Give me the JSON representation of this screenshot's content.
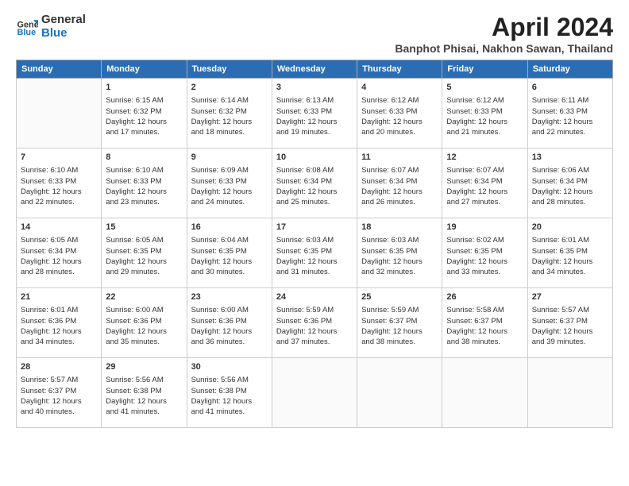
{
  "header": {
    "logo_line1": "General",
    "logo_line2": "Blue",
    "month_title": "April 2024",
    "subtitle": "Banphot Phisai, Nakhon Sawan, Thailand"
  },
  "weekdays": [
    "Sunday",
    "Monday",
    "Tuesday",
    "Wednesday",
    "Thursday",
    "Friday",
    "Saturday"
  ],
  "weeks": [
    [
      {
        "day": "",
        "info": ""
      },
      {
        "day": "1",
        "info": "Sunrise: 6:15 AM\nSunset: 6:32 PM\nDaylight: 12 hours\nand 17 minutes."
      },
      {
        "day": "2",
        "info": "Sunrise: 6:14 AM\nSunset: 6:32 PM\nDaylight: 12 hours\nand 18 minutes."
      },
      {
        "day": "3",
        "info": "Sunrise: 6:13 AM\nSunset: 6:33 PM\nDaylight: 12 hours\nand 19 minutes."
      },
      {
        "day": "4",
        "info": "Sunrise: 6:12 AM\nSunset: 6:33 PM\nDaylight: 12 hours\nand 20 minutes."
      },
      {
        "day": "5",
        "info": "Sunrise: 6:12 AM\nSunset: 6:33 PM\nDaylight: 12 hours\nand 21 minutes."
      },
      {
        "day": "6",
        "info": "Sunrise: 6:11 AM\nSunset: 6:33 PM\nDaylight: 12 hours\nand 22 minutes."
      }
    ],
    [
      {
        "day": "7",
        "info": "Sunrise: 6:10 AM\nSunset: 6:33 PM\nDaylight: 12 hours\nand 22 minutes."
      },
      {
        "day": "8",
        "info": "Sunrise: 6:10 AM\nSunset: 6:33 PM\nDaylight: 12 hours\nand 23 minutes."
      },
      {
        "day": "9",
        "info": "Sunrise: 6:09 AM\nSunset: 6:33 PM\nDaylight: 12 hours\nand 24 minutes."
      },
      {
        "day": "10",
        "info": "Sunrise: 6:08 AM\nSunset: 6:34 PM\nDaylight: 12 hours\nand 25 minutes."
      },
      {
        "day": "11",
        "info": "Sunrise: 6:07 AM\nSunset: 6:34 PM\nDaylight: 12 hours\nand 26 minutes."
      },
      {
        "day": "12",
        "info": "Sunrise: 6:07 AM\nSunset: 6:34 PM\nDaylight: 12 hours\nand 27 minutes."
      },
      {
        "day": "13",
        "info": "Sunrise: 6:06 AM\nSunset: 6:34 PM\nDaylight: 12 hours\nand 28 minutes."
      }
    ],
    [
      {
        "day": "14",
        "info": "Sunrise: 6:05 AM\nSunset: 6:34 PM\nDaylight: 12 hours\nand 28 minutes."
      },
      {
        "day": "15",
        "info": "Sunrise: 6:05 AM\nSunset: 6:35 PM\nDaylight: 12 hours\nand 29 minutes."
      },
      {
        "day": "16",
        "info": "Sunrise: 6:04 AM\nSunset: 6:35 PM\nDaylight: 12 hours\nand 30 minutes."
      },
      {
        "day": "17",
        "info": "Sunrise: 6:03 AM\nSunset: 6:35 PM\nDaylight: 12 hours\nand 31 minutes."
      },
      {
        "day": "18",
        "info": "Sunrise: 6:03 AM\nSunset: 6:35 PM\nDaylight: 12 hours\nand 32 minutes."
      },
      {
        "day": "19",
        "info": "Sunrise: 6:02 AM\nSunset: 6:35 PM\nDaylight: 12 hours\nand 33 minutes."
      },
      {
        "day": "20",
        "info": "Sunrise: 6:01 AM\nSunset: 6:35 PM\nDaylight: 12 hours\nand 34 minutes."
      }
    ],
    [
      {
        "day": "21",
        "info": "Sunrise: 6:01 AM\nSunset: 6:36 PM\nDaylight: 12 hours\nand 34 minutes."
      },
      {
        "day": "22",
        "info": "Sunrise: 6:00 AM\nSunset: 6:36 PM\nDaylight: 12 hours\nand 35 minutes."
      },
      {
        "day": "23",
        "info": "Sunrise: 6:00 AM\nSunset: 6:36 PM\nDaylight: 12 hours\nand 36 minutes."
      },
      {
        "day": "24",
        "info": "Sunrise: 5:59 AM\nSunset: 6:36 PM\nDaylight: 12 hours\nand 37 minutes."
      },
      {
        "day": "25",
        "info": "Sunrise: 5:59 AM\nSunset: 6:37 PM\nDaylight: 12 hours\nand 38 minutes."
      },
      {
        "day": "26",
        "info": "Sunrise: 5:58 AM\nSunset: 6:37 PM\nDaylight: 12 hours\nand 38 minutes."
      },
      {
        "day": "27",
        "info": "Sunrise: 5:57 AM\nSunset: 6:37 PM\nDaylight: 12 hours\nand 39 minutes."
      }
    ],
    [
      {
        "day": "28",
        "info": "Sunrise: 5:57 AM\nSunset: 6:37 PM\nDaylight: 12 hours\nand 40 minutes."
      },
      {
        "day": "29",
        "info": "Sunrise: 5:56 AM\nSunset: 6:38 PM\nDaylight: 12 hours\nand 41 minutes."
      },
      {
        "day": "30",
        "info": "Sunrise: 5:56 AM\nSunset: 6:38 PM\nDaylight: 12 hours\nand 41 minutes."
      },
      {
        "day": "",
        "info": ""
      },
      {
        "day": "",
        "info": ""
      },
      {
        "day": "",
        "info": ""
      },
      {
        "day": "",
        "info": ""
      }
    ]
  ]
}
